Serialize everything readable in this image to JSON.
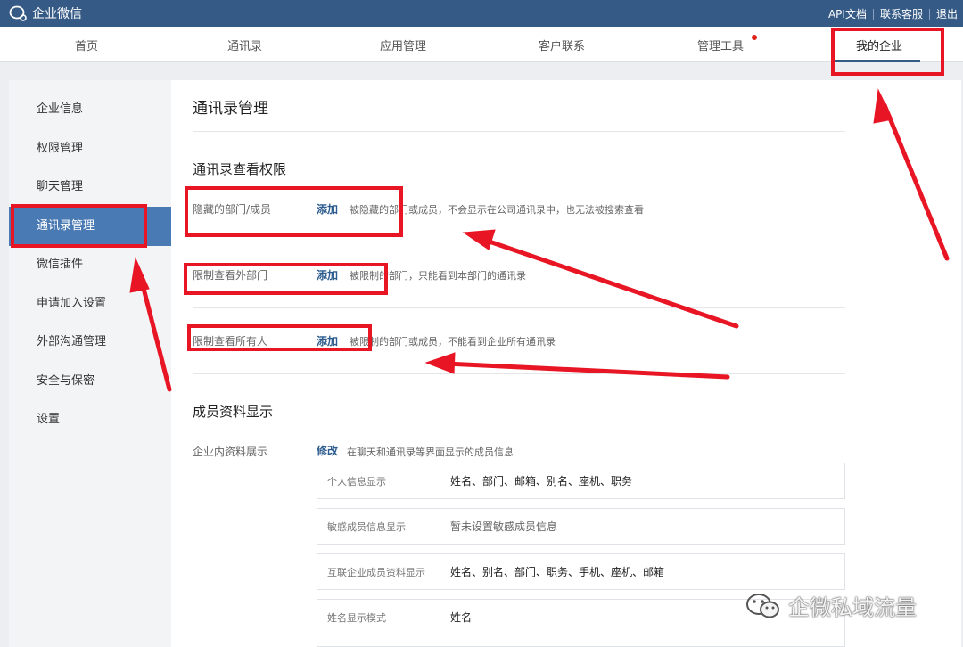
{
  "app": {
    "title": "企业微信"
  },
  "top_links": [
    "API文档",
    "联系客服",
    "退出"
  ],
  "nav": {
    "items": [
      "首页",
      "通讯录",
      "应用管理",
      "客户联系",
      "管理工具",
      "我的企业"
    ],
    "active": "我的企业"
  },
  "sidebar": {
    "items": [
      "企业信息",
      "权限管理",
      "聊天管理",
      "通讯录管理",
      "微信插件",
      "申请加入设置",
      "外部沟通管理",
      "安全与保密",
      "设置"
    ],
    "active": "通讯录管理"
  },
  "main": {
    "title": "通讯录管理",
    "view_section": {
      "title": "通讯录查看权限",
      "rows": [
        {
          "label": "隐藏的部门/成员",
          "action": "添加",
          "desc": "被隐藏的部门或成员，不会显示在公司通讯录中，也无法被搜索查看"
        },
        {
          "label": "限制查看外部门",
          "action": "添加",
          "desc": "被限制的部门，只能看到本部门的通讯录"
        },
        {
          "label": "限制查看所有人",
          "action": "添加",
          "desc": "被限制的部门或成员，不能看到企业所有通讯录"
        }
      ]
    },
    "profile_section": {
      "title": "成员资料显示",
      "label": "企业内资料展示",
      "action": "修改",
      "desc": "在聊天和通讯录等界面显示的成员信息",
      "boxes": [
        {
          "key": "个人信息显示",
          "value": "姓名、部门、邮箱、别名、座机、职务"
        },
        {
          "key": "敏感成员信息显示",
          "value": "暂未设置敏感成员信息"
        },
        {
          "key": "互联企业成员资料显示",
          "value": "姓名、别名、部门、职务、手机、座机、邮箱"
        },
        {
          "key": "姓名显示模式",
          "value": "姓名"
        }
      ]
    }
  },
  "watermark": "企微私域流量",
  "colors": {
    "topbar": "#355a86",
    "accent": "#4a7ab3",
    "annotation": "#e81524",
    "link": "#2d5c8e"
  }
}
